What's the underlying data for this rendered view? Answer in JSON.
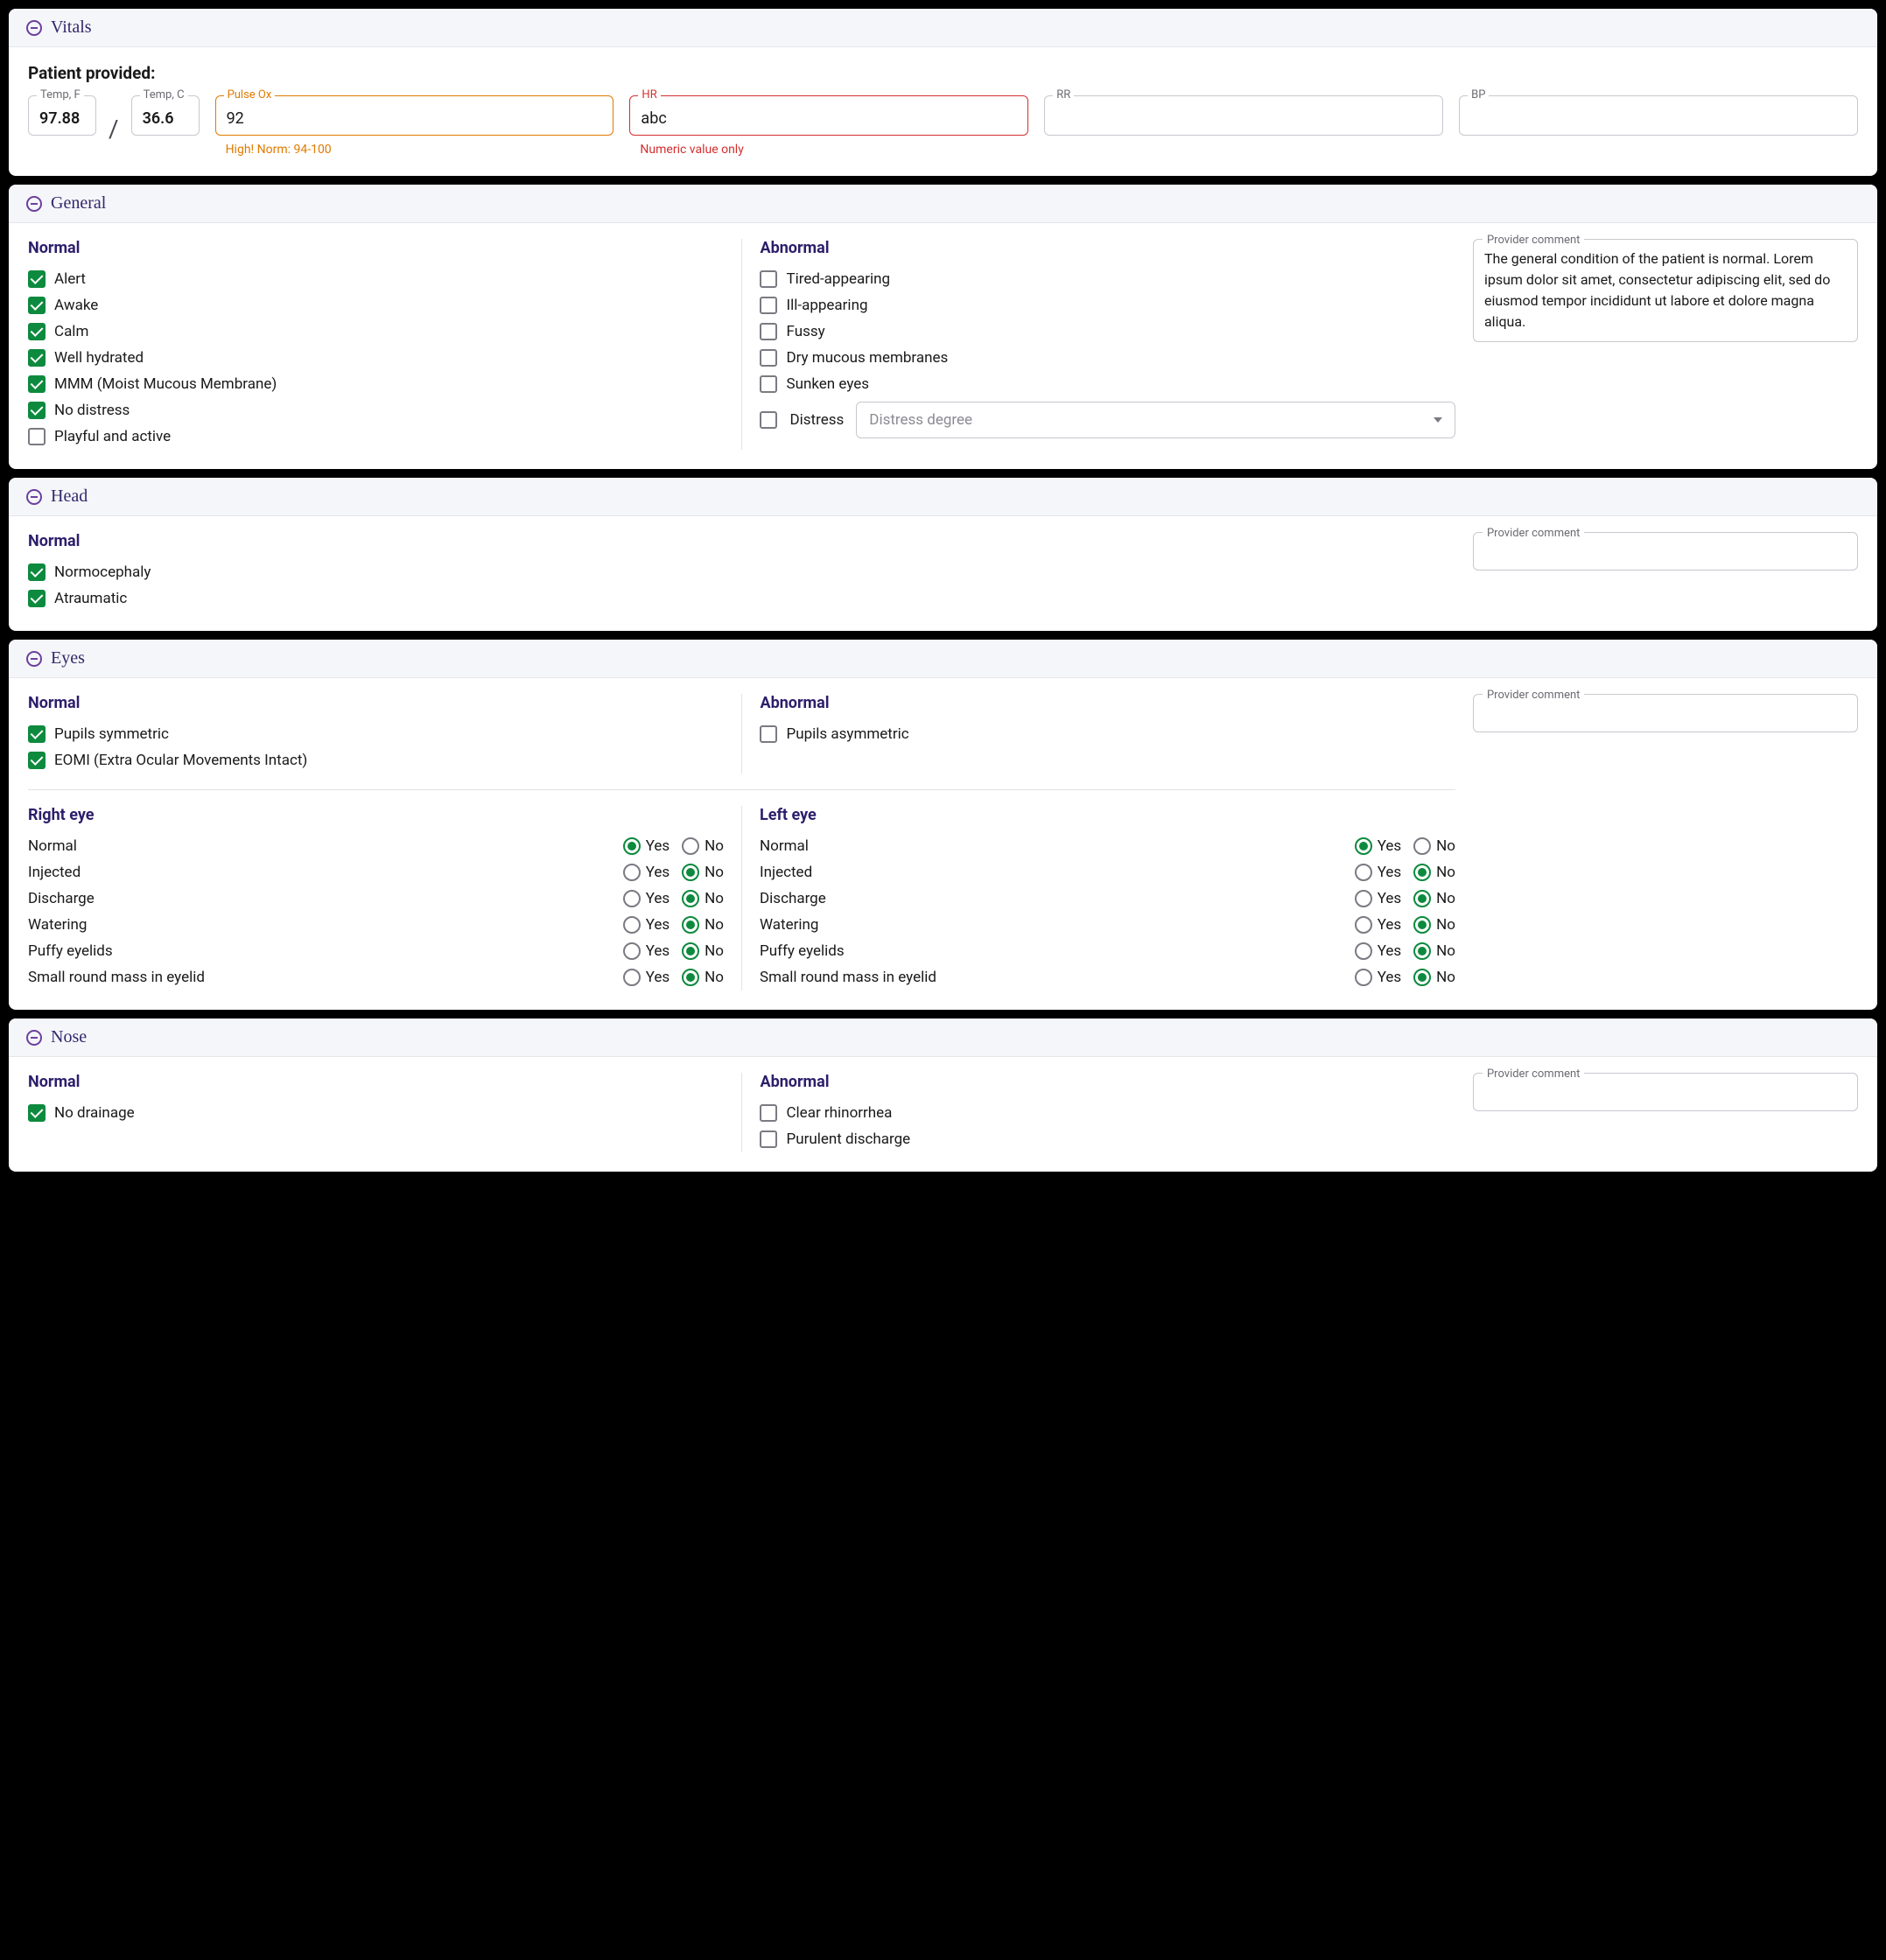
{
  "sections": {
    "vitals": {
      "title": "Vitals",
      "patient_provided": "Patient provided:",
      "temp_f": {
        "label": "Temp, F",
        "value": "97.88"
      },
      "temp_c": {
        "label": "Temp, C",
        "value": "36.6"
      },
      "pulse_ox": {
        "label": "Pulse Ox",
        "value": "92",
        "helper": "High! Norm: 94-100"
      },
      "hr": {
        "label": "HR",
        "value": "abc",
        "helper": "Numeric value only"
      },
      "rr": {
        "label": "RR",
        "value": ""
      },
      "bp": {
        "label": "BP",
        "value": ""
      }
    },
    "general": {
      "title": "General",
      "normal_heading": "Normal",
      "abnormal_heading": "Abnormal",
      "normal": [
        {
          "label": "Alert",
          "checked": true
        },
        {
          "label": "Awake",
          "checked": true
        },
        {
          "label": "Calm",
          "checked": true
        },
        {
          "label": "Well hydrated",
          "checked": true
        },
        {
          "label": "MMM (Moist Mucous Membrane)",
          "checked": true
        },
        {
          "label": "No distress",
          "checked": true
        },
        {
          "label": "Playful and active",
          "checked": false
        }
      ],
      "abnormal": [
        {
          "label": "Tired-appearing",
          "checked": false
        },
        {
          "label": "Ill-appearing",
          "checked": false
        },
        {
          "label": "Fussy",
          "checked": false
        },
        {
          "label": "Dry mucous membranes",
          "checked": false
        },
        {
          "label": "Sunken eyes",
          "checked": false
        }
      ],
      "distress": {
        "label": "Distress",
        "placeholder": "Distress degree",
        "checked": false
      },
      "comment_label": "Provider comment",
      "comment": "The general condition of the patient is normal. Lorem ipsum dolor sit amet, consectetur adipiscing elit, sed do eiusmod tempor incididunt ut labore et dolore magna aliqua."
    },
    "head": {
      "title": "Head",
      "normal_heading": "Normal",
      "normal": [
        {
          "label": "Normocephaly",
          "checked": true
        },
        {
          "label": "Atraumatic",
          "checked": true
        }
      ],
      "comment_label": "Provider comment",
      "comment": ""
    },
    "eyes": {
      "title": "Eyes",
      "normal_heading": "Normal",
      "abnormal_heading": "Abnormal",
      "normal": [
        {
          "label": "Pupils symmetric",
          "checked": true
        },
        {
          "label": "EOMI (Extra Ocular Movements Intact)",
          "checked": true
        }
      ],
      "abnormal": [
        {
          "label": "Pupils asymmetric",
          "checked": false
        }
      ],
      "comment_label": "Provider comment",
      "comment": "",
      "right_heading": "Right eye",
      "left_heading": "Left eye",
      "yes": "Yes",
      "no": "No",
      "findings": [
        {
          "label": "Normal",
          "right": "yes",
          "left": "yes"
        },
        {
          "label": "Injected",
          "right": "no",
          "left": "no"
        },
        {
          "label": "Discharge",
          "right": "no",
          "left": "no"
        },
        {
          "label": "Watering",
          "right": "no",
          "left": "no"
        },
        {
          "label": "Puffy eyelids",
          "right": "no",
          "left": "no"
        },
        {
          "label": "Small round mass in eyelid",
          "right": "no",
          "left": "no"
        }
      ]
    },
    "nose": {
      "title": "Nose",
      "normal_heading": "Normal",
      "abnormal_heading": "Abnormal",
      "normal": [
        {
          "label": "No drainage",
          "checked": true
        }
      ],
      "abnormal": [
        {
          "label": "Clear rhinorrhea",
          "checked": false
        },
        {
          "label": "Purulent discharge",
          "checked": false
        }
      ],
      "comment_label": "Provider comment",
      "comment": ""
    }
  }
}
